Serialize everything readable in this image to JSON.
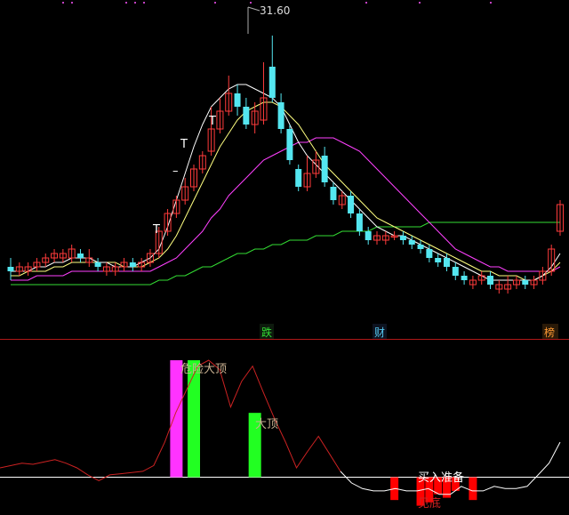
{
  "colors": {
    "background": "#000000",
    "up": "#ff3b3b",
    "down": "#54e6f0",
    "ma_fast": "#ffffff",
    "ma_mid": "#ffff80",
    "ma_slow": "#ff40ff",
    "ma_long": "#33dd33",
    "grid": "#b01818",
    "oscillator": "#cc2222",
    "oscillator_low": "#ffffff",
    "magenta_bar": "#ff33ff",
    "green_bar": "#22ff22",
    "red_bar": "#ff0000",
    "label_text": "#c8b090"
  },
  "price_panel": {
    "peak_label": "31.60",
    "signal_marks": [
      "T",
      "T",
      "T",
      "–"
    ],
    "bottom_tags": [
      {
        "text": "跌",
        "color": "#33dd33"
      },
      {
        "text": "财",
        "color": "#54c8f0"
      },
      {
        "text": "榜",
        "color": "#ff9933"
      }
    ]
  },
  "indicator_panel": {
    "labels": {
      "danger_top": "危险大顶",
      "big_top": "大顶",
      "buy_ready": "买入准备",
      "bottom": "见底"
    }
  },
  "chart_data": {
    "type": "candlestick",
    "title": "",
    "xlabel": "",
    "ylabel": "",
    "peak_value": 31.6,
    "candles": [
      {
        "o": 0.47,
        "c": 0.48,
        "h": 0.5,
        "l": 0.45,
        "dir": "down"
      },
      {
        "o": 0.47,
        "c": 0.48,
        "h": 0.49,
        "l": 0.46,
        "dir": "up"
      },
      {
        "o": 0.47,
        "c": 0.48,
        "h": 0.49,
        "l": 0.46,
        "dir": "up"
      },
      {
        "o": 0.48,
        "c": 0.49,
        "h": 0.5,
        "l": 0.47,
        "dir": "up"
      },
      {
        "o": 0.49,
        "c": 0.5,
        "h": 0.51,
        "l": 0.48,
        "dir": "up"
      },
      {
        "o": 0.5,
        "c": 0.51,
        "h": 0.52,
        "l": 0.49,
        "dir": "up"
      },
      {
        "o": 0.5,
        "c": 0.51,
        "h": 0.52,
        "l": 0.49,
        "dir": "up"
      },
      {
        "o": 0.5,
        "c": 0.52,
        "h": 0.53,
        "l": 0.49,
        "dir": "up"
      },
      {
        "o": 0.5,
        "c": 0.51,
        "h": 0.52,
        "l": 0.49,
        "dir": "down"
      },
      {
        "o": 0.49,
        "c": 0.5,
        "h": 0.52,
        "l": 0.48,
        "dir": "up"
      },
      {
        "o": 0.48,
        "c": 0.49,
        "h": 0.5,
        "l": 0.47,
        "dir": "down"
      },
      {
        "o": 0.47,
        "c": 0.48,
        "h": 0.49,
        "l": 0.46,
        "dir": "up"
      },
      {
        "o": 0.47,
        "c": 0.48,
        "h": 0.49,
        "l": 0.46,
        "dir": "up"
      },
      {
        "o": 0.48,
        "c": 0.49,
        "h": 0.5,
        "l": 0.47,
        "dir": "up"
      },
      {
        "o": 0.48,
        "c": 0.49,
        "h": 0.5,
        "l": 0.47,
        "dir": "down"
      },
      {
        "o": 0.48,
        "c": 0.49,
        "h": 0.5,
        "l": 0.47,
        "dir": "up"
      },
      {
        "o": 0.49,
        "c": 0.51,
        "h": 0.52,
        "l": 0.48,
        "dir": "up"
      },
      {
        "o": 0.51,
        "c": 0.56,
        "h": 0.57,
        "l": 0.5,
        "dir": "up"
      },
      {
        "o": 0.56,
        "c": 0.6,
        "h": 0.61,
        "l": 0.55,
        "dir": "up"
      },
      {
        "o": 0.6,
        "c": 0.63,
        "h": 0.64,
        "l": 0.59,
        "dir": "up"
      },
      {
        "o": 0.63,
        "c": 0.66,
        "h": 0.68,
        "l": 0.62,
        "dir": "up"
      },
      {
        "o": 0.66,
        "c": 0.7,
        "h": 0.71,
        "l": 0.65,
        "dir": "up"
      },
      {
        "o": 0.7,
        "c": 0.73,
        "h": 0.74,
        "l": 0.69,
        "dir": "up"
      },
      {
        "o": 0.74,
        "c": 0.79,
        "h": 0.84,
        "l": 0.73,
        "dir": "up"
      },
      {
        "o": 0.79,
        "c": 0.83,
        "h": 0.86,
        "l": 0.78,
        "dir": "up"
      },
      {
        "o": 0.83,
        "c": 0.87,
        "h": 0.91,
        "l": 0.82,
        "dir": "up"
      },
      {
        "o": 0.87,
        "c": 0.84,
        "h": 0.89,
        "l": 0.82,
        "dir": "down"
      },
      {
        "o": 0.84,
        "c": 0.8,
        "h": 0.86,
        "l": 0.79,
        "dir": "down"
      },
      {
        "o": 0.8,
        "c": 0.83,
        "h": 0.85,
        "l": 0.78,
        "dir": "up"
      },
      {
        "o": 0.81,
        "c": 0.86,
        "h": 0.94,
        "l": 0.8,
        "dir": "up"
      },
      {
        "o": 0.93,
        "c": 0.86,
        "h": 1.0,
        "l": 0.85,
        "dir": "down"
      },
      {
        "o": 0.85,
        "c": 0.79,
        "h": 0.87,
        "l": 0.78,
        "dir": "down"
      },
      {
        "o": 0.79,
        "c": 0.72,
        "h": 0.8,
        "l": 0.71,
        "dir": "down"
      },
      {
        "o": 0.7,
        "c": 0.66,
        "h": 0.71,
        "l": 0.65,
        "dir": "down"
      },
      {
        "o": 0.66,
        "c": 0.69,
        "h": 0.73,
        "l": 0.65,
        "dir": "up"
      },
      {
        "o": 0.69,
        "c": 0.72,
        "h": 0.74,
        "l": 0.68,
        "dir": "up"
      },
      {
        "o": 0.73,
        "c": 0.67,
        "h": 0.75,
        "l": 0.66,
        "dir": "down"
      },
      {
        "o": 0.66,
        "c": 0.63,
        "h": 0.67,
        "l": 0.62,
        "dir": "down"
      },
      {
        "o": 0.62,
        "c": 0.64,
        "h": 0.65,
        "l": 0.61,
        "dir": "up"
      },
      {
        "o": 0.64,
        "c": 0.6,
        "h": 0.65,
        "l": 0.59,
        "dir": "down"
      },
      {
        "o": 0.6,
        "c": 0.56,
        "h": 0.61,
        "l": 0.55,
        "dir": "down"
      },
      {
        "o": 0.56,
        "c": 0.54,
        "h": 0.57,
        "l": 0.53,
        "dir": "down"
      },
      {
        "o": 0.54,
        "c": 0.55,
        "h": 0.56,
        "l": 0.53,
        "dir": "up"
      },
      {
        "o": 0.54,
        "c": 0.55,
        "h": 0.56,
        "l": 0.53,
        "dir": "up"
      },
      {
        "o": 0.55,
        "c": 0.55,
        "h": 0.56,
        "l": 0.54,
        "dir": "up"
      },
      {
        "o": 0.55,
        "c": 0.54,
        "h": 0.56,
        "l": 0.53,
        "dir": "down"
      },
      {
        "o": 0.54,
        "c": 0.53,
        "h": 0.55,
        "l": 0.52,
        "dir": "down"
      },
      {
        "o": 0.53,
        "c": 0.52,
        "h": 0.54,
        "l": 0.51,
        "dir": "down"
      },
      {
        "o": 0.52,
        "c": 0.5,
        "h": 0.53,
        "l": 0.49,
        "dir": "down"
      },
      {
        "o": 0.5,
        "c": 0.49,
        "h": 0.51,
        "l": 0.48,
        "dir": "down"
      },
      {
        "o": 0.5,
        "c": 0.48,
        "h": 0.51,
        "l": 0.47,
        "dir": "down"
      },
      {
        "o": 0.48,
        "c": 0.46,
        "h": 0.49,
        "l": 0.45,
        "dir": "down"
      },
      {
        "o": 0.46,
        "c": 0.45,
        "h": 0.47,
        "l": 0.44,
        "dir": "down"
      },
      {
        "o": 0.45,
        "c": 0.44,
        "h": 0.46,
        "l": 0.43,
        "dir": "up"
      },
      {
        "o": 0.45,
        "c": 0.46,
        "h": 0.47,
        "l": 0.44,
        "dir": "up"
      },
      {
        "o": 0.46,
        "c": 0.44,
        "h": 0.47,
        "l": 0.43,
        "dir": "down"
      },
      {
        "o": 0.44,
        "c": 0.43,
        "h": 0.45,
        "l": 0.42,
        "dir": "up"
      },
      {
        "o": 0.43,
        "c": 0.44,
        "h": 0.46,
        "l": 0.42,
        "dir": "up"
      },
      {
        "o": 0.44,
        "c": 0.45,
        "h": 0.46,
        "l": 0.43,
        "dir": "up"
      },
      {
        "o": 0.45,
        "c": 0.44,
        "h": 0.46,
        "l": 0.43,
        "dir": "down"
      },
      {
        "o": 0.44,
        "c": 0.45,
        "h": 0.46,
        "l": 0.43,
        "dir": "up"
      },
      {
        "o": 0.45,
        "c": 0.47,
        "h": 0.48,
        "l": 0.44,
        "dir": "up"
      },
      {
        "o": 0.47,
        "c": 0.52,
        "h": 0.53,
        "l": 0.46,
        "dir": "up"
      },
      {
        "o": 0.56,
        "c": 0.62,
        "h": 0.63,
        "l": 0.55,
        "dir": "up"
      }
    ],
    "ma_fast": [
      0.47,
      0.47,
      0.47,
      0.48,
      0.48,
      0.49,
      0.49,
      0.5,
      0.5,
      0.5,
      0.49,
      0.49,
      0.48,
      0.48,
      0.48,
      0.49,
      0.5,
      0.52,
      0.57,
      0.63,
      0.69,
      0.75,
      0.8,
      0.84,
      0.86,
      0.88,
      0.89,
      0.89,
      0.88,
      0.87,
      0.86,
      0.84,
      0.8,
      0.76,
      0.73,
      0.71,
      0.69,
      0.67,
      0.65,
      0.63,
      0.61,
      0.59,
      0.57,
      0.56,
      0.55,
      0.55,
      0.54,
      0.53,
      0.52,
      0.51,
      0.5,
      0.49,
      0.48,
      0.47,
      0.46,
      0.45,
      0.45,
      0.45,
      0.45,
      0.45,
      0.45,
      0.46,
      0.48,
      0.51
    ],
    "ma_mid": [
      0.46,
      0.46,
      0.47,
      0.47,
      0.47,
      0.48,
      0.48,
      0.49,
      0.49,
      0.49,
      0.49,
      0.49,
      0.49,
      0.48,
      0.48,
      0.48,
      0.49,
      0.5,
      0.52,
      0.55,
      0.59,
      0.63,
      0.67,
      0.71,
      0.75,
      0.78,
      0.81,
      0.83,
      0.84,
      0.85,
      0.85,
      0.84,
      0.82,
      0.8,
      0.77,
      0.74,
      0.71,
      0.69,
      0.67,
      0.65,
      0.63,
      0.61,
      0.59,
      0.58,
      0.57,
      0.56,
      0.55,
      0.54,
      0.53,
      0.52,
      0.51,
      0.5,
      0.49,
      0.48,
      0.47,
      0.47,
      0.46,
      0.46,
      0.46,
      0.45,
      0.45,
      0.46,
      0.47,
      0.49
    ],
    "ma_slow": [
      0.45,
      0.45,
      0.45,
      0.46,
      0.46,
      0.46,
      0.46,
      0.47,
      0.47,
      0.47,
      0.47,
      0.47,
      0.47,
      0.47,
      0.47,
      0.47,
      0.47,
      0.48,
      0.49,
      0.5,
      0.52,
      0.54,
      0.56,
      0.59,
      0.61,
      0.64,
      0.66,
      0.68,
      0.7,
      0.72,
      0.73,
      0.74,
      0.75,
      0.76,
      0.76,
      0.77,
      0.77,
      0.77,
      0.76,
      0.75,
      0.74,
      0.72,
      0.7,
      0.68,
      0.66,
      0.64,
      0.62,
      0.6,
      0.58,
      0.56,
      0.54,
      0.52,
      0.51,
      0.5,
      0.49,
      0.48,
      0.48,
      0.47,
      0.47,
      0.47,
      0.47,
      0.47,
      0.47,
      0.48
    ],
    "ma_long": [
      0.44,
      0.44,
      0.44,
      0.44,
      0.44,
      0.44,
      0.44,
      0.44,
      0.44,
      0.44,
      0.44,
      0.44,
      0.44,
      0.44,
      0.44,
      0.44,
      0.44,
      0.45,
      0.45,
      0.46,
      0.46,
      0.47,
      0.48,
      0.48,
      0.49,
      0.5,
      0.51,
      0.51,
      0.52,
      0.52,
      0.53,
      0.53,
      0.54,
      0.54,
      0.54,
      0.55,
      0.55,
      0.55,
      0.56,
      0.56,
      0.56,
      0.56,
      0.57,
      0.57,
      0.57,
      0.57,
      0.57,
      0.57,
      0.58,
      0.58,
      0.58,
      0.58,
      0.58,
      0.58,
      0.58,
      0.58,
      0.58,
      0.58,
      0.58,
      0.58,
      0.58,
      0.58,
      0.58,
      0.58
    ],
    "oscillator": [
      0.08,
      0.1,
      0.12,
      0.11,
      0.13,
      0.15,
      0.12,
      0.08,
      0.02,
      -0.03,
      0.02,
      0.03,
      0.04,
      0.05,
      0.1,
      0.3,
      0.55,
      0.75,
      0.95,
      1.0,
      0.92,
      0.6,
      0.82,
      0.95,
      0.72,
      0.5,
      0.3,
      0.08,
      0.22,
      0.35,
      0.2,
      0.05,
      -0.05,
      -0.1,
      -0.12,
      -0.12,
      -0.1,
      -0.12,
      -0.12,
      -0.1,
      -0.15,
      -0.15,
      -0.08,
      -0.12,
      -0.12,
      -0.08,
      -0.1,
      -0.1,
      -0.08,
      0.02,
      0.12,
      0.3
    ],
    "indicator_bars": [
      {
        "index": 19,
        "value": 1.0,
        "kind": "magenta"
      },
      {
        "index": 21,
        "value": 1.0,
        "kind": "green"
      },
      {
        "index": 28,
        "value": 0.55,
        "kind": "green"
      },
      {
        "index": 44,
        "value": -0.2,
        "kind": "red"
      },
      {
        "index": 47,
        "value": -0.25,
        "kind": "red"
      },
      {
        "index": 48,
        "value": -0.22,
        "kind": "red"
      },
      {
        "index": 49,
        "value": -0.15,
        "kind": "red"
      },
      {
        "index": 50,
        "value": -0.18,
        "kind": "red"
      },
      {
        "index": 51,
        "value": -0.12,
        "kind": "red"
      },
      {
        "index": 53,
        "value": -0.2,
        "kind": "red"
      }
    ]
  }
}
